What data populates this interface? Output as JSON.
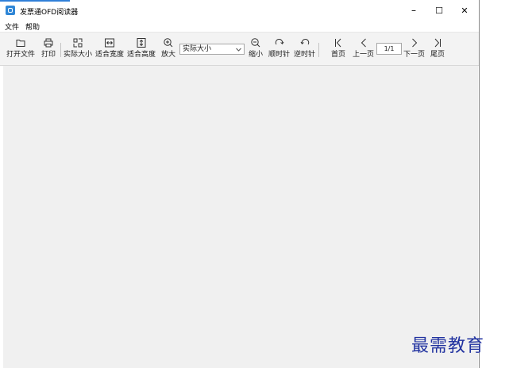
{
  "window": {
    "title": "发票通OFD阅读器",
    "controls": {
      "minimize": "–",
      "maximize": "☐",
      "close": "✕"
    }
  },
  "menu": {
    "file": "文件",
    "help": "帮助"
  },
  "toolbar": {
    "open": "打开文件",
    "print": "打印",
    "actual_size": "实际大小",
    "fit_width": "适合宽度",
    "fit_height": "适合高度",
    "zoom_in": "放大",
    "zoom_select_value": "实际大小",
    "zoom_out": "缩小",
    "rotate_cw": "顺时针",
    "rotate_ccw": "逆时针",
    "first_page": "首页",
    "prev_page": "上一页",
    "page_indicator": "1/1",
    "next_page": "下一页",
    "last_page": "尾页"
  },
  "watermark": "最需教育",
  "colors": {
    "accent": "#2f7fd8",
    "watermark": "#2233a0",
    "content_bg": "#f0f0f0"
  }
}
